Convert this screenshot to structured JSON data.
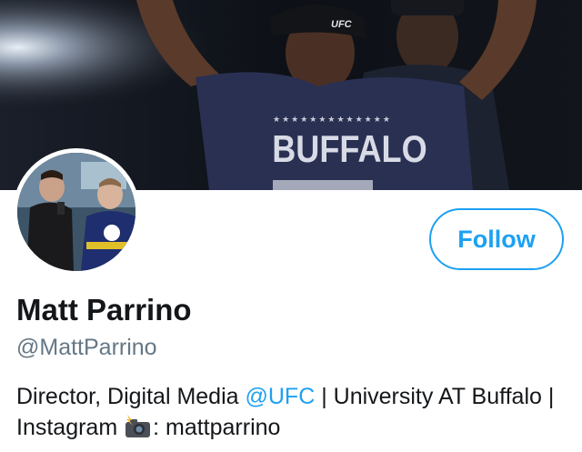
{
  "profile": {
    "display_name": "Matt Parrino",
    "handle": "@MattParrino",
    "follow_label": "Follow",
    "bio": {
      "part1": "Director, Digital Media ",
      "mention": "@UFC",
      "part2": " | University AT Buffalo | Instagram ",
      "icon": "camera-with-flash-icon",
      "part3": ": mattparrino"
    }
  },
  "banner": {
    "shirt_text": "BUFFALO",
    "cap_text": "UFC"
  },
  "colors": {
    "accent": "#1da1f2",
    "text_primary": "#14171a",
    "text_secondary": "#657786"
  }
}
